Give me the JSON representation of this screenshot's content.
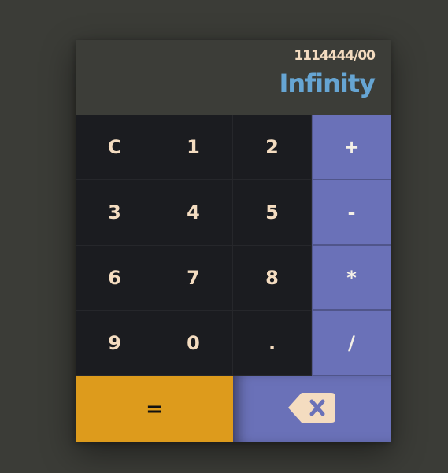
{
  "display": {
    "expression": "1114444/00",
    "result": "Infinity"
  },
  "keys": [
    {
      "label": "C",
      "type": "num",
      "name": "clear-button"
    },
    {
      "label": "1",
      "type": "num",
      "name": "digit-1-button"
    },
    {
      "label": "2",
      "type": "num",
      "name": "digit-2-button"
    },
    {
      "label": "+",
      "type": "op",
      "name": "add-button"
    },
    {
      "label": "3",
      "type": "num",
      "name": "digit-3-button"
    },
    {
      "label": "4",
      "type": "num",
      "name": "digit-4-button"
    },
    {
      "label": "5",
      "type": "num",
      "name": "digit-5-button"
    },
    {
      "label": "-",
      "type": "op",
      "name": "subtract-button"
    },
    {
      "label": "6",
      "type": "num",
      "name": "digit-6-button"
    },
    {
      "label": "7",
      "type": "num",
      "name": "digit-7-button"
    },
    {
      "label": "8",
      "type": "num",
      "name": "digit-8-button"
    },
    {
      "label": "*",
      "type": "op",
      "name": "multiply-button"
    },
    {
      "label": "9",
      "type": "num",
      "name": "digit-9-button"
    },
    {
      "label": "0",
      "type": "num",
      "name": "digit-0-button"
    },
    {
      "label": ".",
      "type": "num",
      "name": "decimal-point-button"
    },
    {
      "label": "/",
      "type": "op",
      "name": "divide-button"
    }
  ],
  "bottom": {
    "equals_label": "=",
    "backspace_icon": "backspace-icon"
  },
  "colors": {
    "background": "#3b3c37",
    "display_bg": "#3c3d38",
    "keypad_bg": "#1b1c20",
    "operator_bg": "#6a71b8",
    "equals_bg": "#dd9b1c",
    "result_text": "#66a5d3",
    "key_text": "#f4dcc0"
  }
}
